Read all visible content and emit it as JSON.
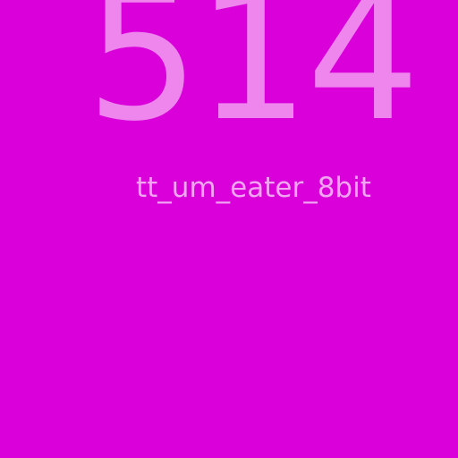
{
  "display": {
    "value": "514",
    "caption": "tt_um_eater_8bit"
  },
  "colors": {
    "background": "#DA00DA",
    "number": "#EE86EE",
    "caption": "#F1A6F1"
  }
}
